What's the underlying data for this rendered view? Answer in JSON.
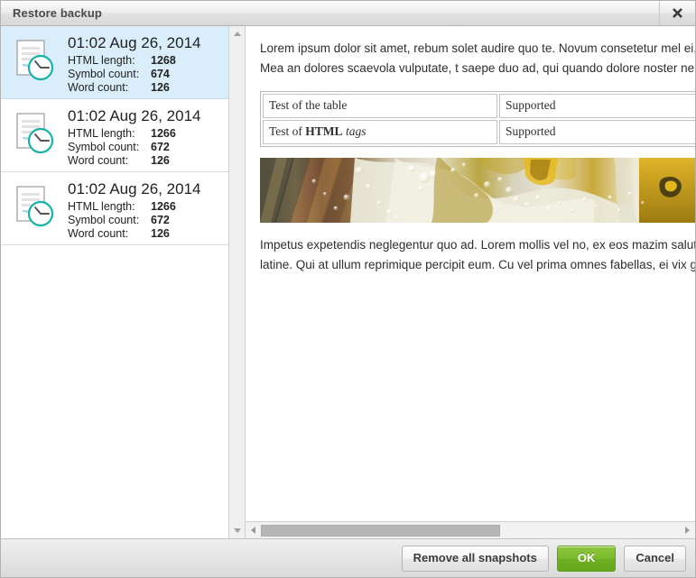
{
  "dialog": {
    "title": "Restore backup",
    "close_icon": "close-icon"
  },
  "snapshots": {
    "labels": {
      "html_length": "HTML length:",
      "symbol_count": "Symbol count:",
      "word_count": "Word count:"
    },
    "items": [
      {
        "date": "01:02 Aug 26, 2014",
        "html_length": "1268",
        "symbol_count": "674",
        "word_count": "126",
        "selected": true
      },
      {
        "date": "01:02 Aug 26, 2014",
        "html_length": "1266",
        "symbol_count": "672",
        "word_count": "126",
        "selected": false
      },
      {
        "date": "01:02 Aug 26, 2014",
        "html_length": "1266",
        "symbol_count": "672",
        "word_count": "126",
        "selected": false
      }
    ]
  },
  "preview": {
    "paragraph_top": "Lorem ipsum dolor sit amet, rebum solet audire quo te. Novum consetetur mel ei, Sea iriure virtute at, ea nostro nonumes qui. Mea an dolores scaevola vulputate, t saepe duo ad, qui quando dolore noster ne. Eam cu prompta deseruisse, ex mel e",
    "table": {
      "rows": [
        {
          "label_plain": "Test of the table",
          "value": "Supported"
        },
        {
          "label_prefix": "Test of ",
          "label_bold": "HTML",
          "label_italic": " tags",
          "value": "Supported"
        }
      ]
    },
    "image_alt": "beer-bubbles-photo",
    "paragraph_bottom": "Impetus expetendis neglegentur quo ad. Lorem mollis vel no, ex eos mazim salut an laudem reprehendunt vis, has no natum latine. Qui at ullum reprimique percipit eum. Cu vel prima omnes fabellas, ei vix graece option!!!"
  },
  "scrollbars": {
    "up_arrow_icon": "triangle-up-icon",
    "down_arrow_icon": "triangle-down-icon",
    "left_arrow_icon": "triangle-left-icon",
    "right_arrow_icon": "triangle-right-icon"
  },
  "footer": {
    "remove_all_label": "Remove all snapshots",
    "ok_label": "OK",
    "cancel_label": "Cancel"
  },
  "colors": {
    "selection": "#d9edfb",
    "ok_button": "#7cbb2c",
    "icon_accent": "#18b2a8"
  }
}
